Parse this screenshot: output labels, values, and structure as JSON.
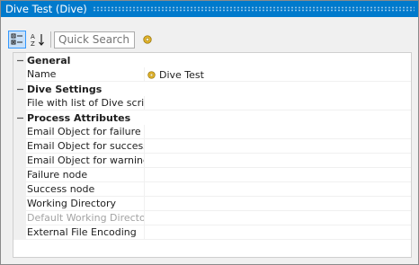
{
  "window": {
    "title": "Dive Test (Dive)"
  },
  "toolbar": {
    "categorized_icon": "categorized-view-icon",
    "alphabetical_icon": "sort-alphabetical-icon",
    "search_placeholder": "Quick Search",
    "coin_icon": "coin-icon"
  },
  "grid": {
    "categories": [
      {
        "label": "General",
        "properties": [
          {
            "name": "Name",
            "value": "Dive Test",
            "value_icon": "coin-icon"
          }
        ]
      },
      {
        "label": "Dive Settings",
        "properties": [
          {
            "name": "File with list of Dive scripts",
            "value": ""
          }
        ]
      },
      {
        "label": "Process Attributes",
        "properties": [
          {
            "name": "Email Object for failure",
            "value": ""
          },
          {
            "name": "Email Object for success",
            "value": ""
          },
          {
            "name": "Email Object for warning",
            "value": ""
          },
          {
            "name": "Failure node",
            "value": ""
          },
          {
            "name": "Success node",
            "value": ""
          },
          {
            "name": "Working Directory",
            "value": ""
          },
          {
            "name": "Default Working Directory",
            "value": "",
            "disabled": true
          },
          {
            "name": "External File Encoding",
            "value": ""
          }
        ]
      }
    ]
  },
  "colors": {
    "titlebar": "#007acc",
    "selected_button": "#c9e0f7",
    "disabled_text": "#a3a3a3",
    "coin": "#d9a520"
  }
}
